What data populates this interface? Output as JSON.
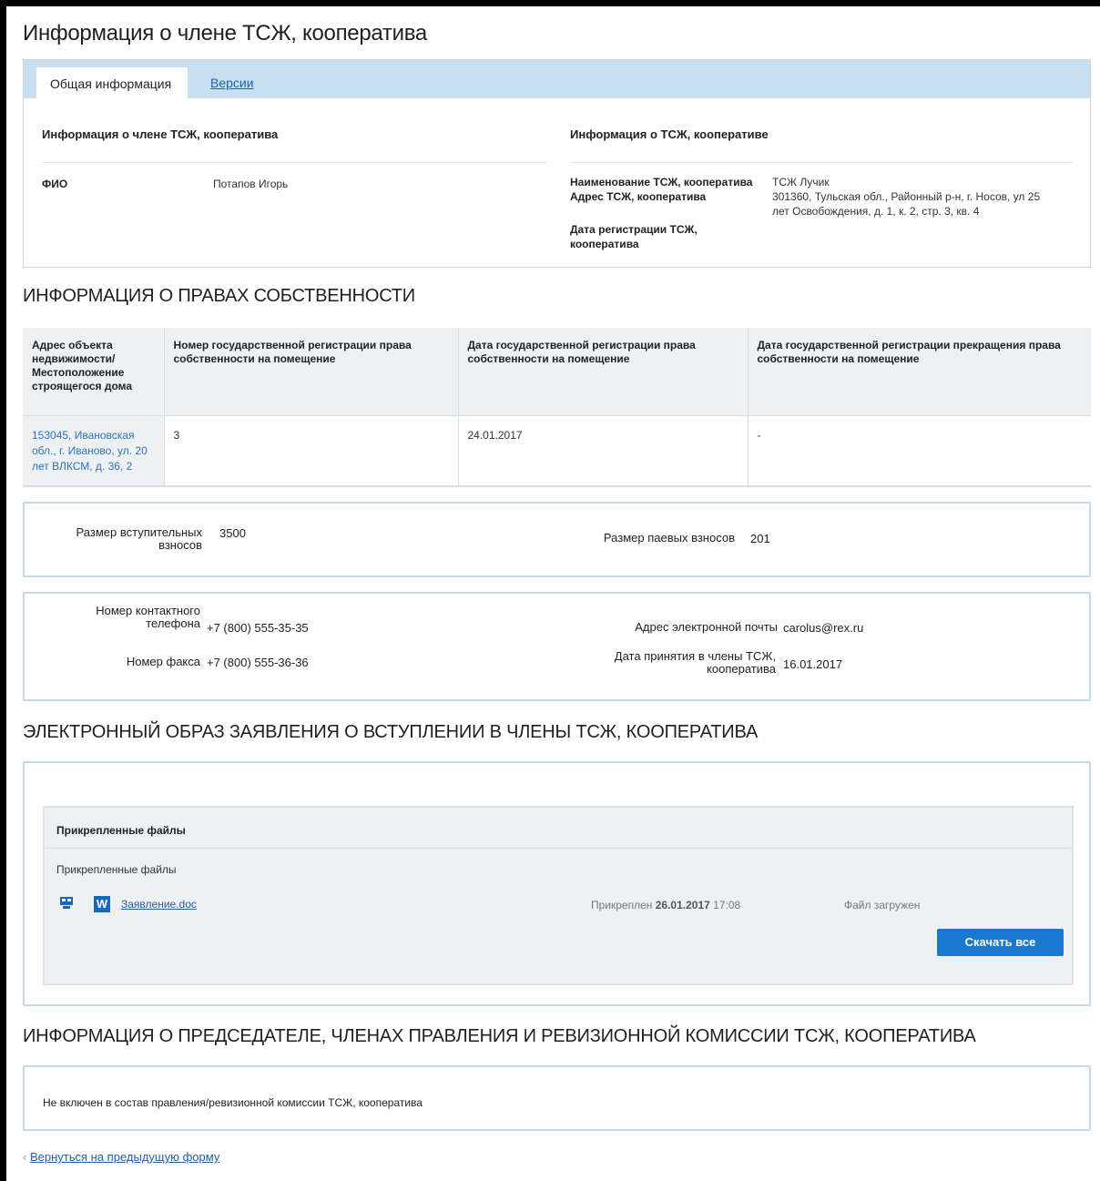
{
  "page": {
    "title": "Информация о члене ТСЖ, кооператива"
  },
  "tabs": {
    "general": "Общая информация",
    "versions": "Версии"
  },
  "member_info": {
    "heading": "Информация о члене ТСЖ, кооператива",
    "fio_label": "ФИО",
    "fio_value": "Потапов Игорь"
  },
  "hoa_info": {
    "heading": "Информация о ТСЖ, кооперативе",
    "name_label": "Наименование ТСЖ, кооператива",
    "name_value": "ТСЖ Лучик",
    "address_label": "Адрес ТСЖ, кооператива",
    "address_value_line1": "301360, Тульская обл., Районный р-н, г. Носов, ул 25",
    "address_value_line2": "лет Освобождения, д. 1, к. 2, стр. 3, кв. 4",
    "reg_date_label_line1": "Дата регистрации ТСЖ,",
    "reg_date_label_line2": "кооператива"
  },
  "ownership": {
    "heading": "ИНФОРМАЦИЯ О ПРАВАХ СОБСТВЕННОСТИ",
    "columns": [
      "Адрес объекта недвижимости/ Местоположение строящегося дома",
      "Номер государственной регистрации права собственности на помещение",
      "Дата государственной регистрации права собственности на помещение",
      "Дата государственной регистрации прекращения права собственности на помещение"
    ],
    "rows": [
      {
        "address": "153045, Ивановская обл., г. Иваново, ул. 20 лет ВЛКСМ, д. 36, 2",
        "reg_number": "3",
        "reg_date": "24.01.2017",
        "end_date": "-"
      }
    ]
  },
  "fees": {
    "entry_label_line1": "Размер вступительных",
    "entry_label_line2": "взносов",
    "entry_value": "3500",
    "share_label": "Размер паевых взносов",
    "share_value": "201"
  },
  "contacts": {
    "phone_label_line1": "Номер контактного",
    "phone_label_line2": "телефона",
    "phone_value": "+7 (800) 555-35-35",
    "fax_label": "Номер факса",
    "fax_value": "+7 (800) 555-36-36",
    "email_label": "Адрес электронной почты",
    "email_value": "carolus@rex.ru",
    "join_label_line1": "Дата принятия в члены ТСЖ,",
    "join_label_line2": "кооператива",
    "join_value": "16.01.2017"
  },
  "application": {
    "heading": "ЭЛЕКТРОННЫЙ ОБРАЗ ЗАЯВЛЕНИЯ О ВСТУПЛЕНИИ В ЧЛЕНЫ ТСЖ, КООПЕРАТИВА",
    "panel_title": "Прикрепленные файлы",
    "list_title": "Прикрепленные файлы",
    "file_name": "Заявление.doc",
    "attached_prefix": "Прикреплен",
    "attached_date": "26.01.2017",
    "attached_time": "17:08",
    "status": "Файл загружен",
    "download_all": "Скачать все"
  },
  "board": {
    "heading": "ИНФОРМАЦИЯ О ПРЕДСЕДАТЕЛЕ, ЧЛЕНАХ ПРАВЛЕНИЯ И РЕВИЗИОННОЙ КОМИССИИ ТСЖ, КООПЕРАТИВА",
    "text": "Не включен в состав правления/ревизионной комиссии ТСЖ, кооператива"
  },
  "back_link": {
    "arrow": "‹",
    "label": "Вернуться на предыдущую форму"
  },
  "colors": {
    "accent": "#1978d0",
    "link": "#2160a6",
    "tabbar": "#c9e0f3",
    "border": "#c7d8ea"
  }
}
